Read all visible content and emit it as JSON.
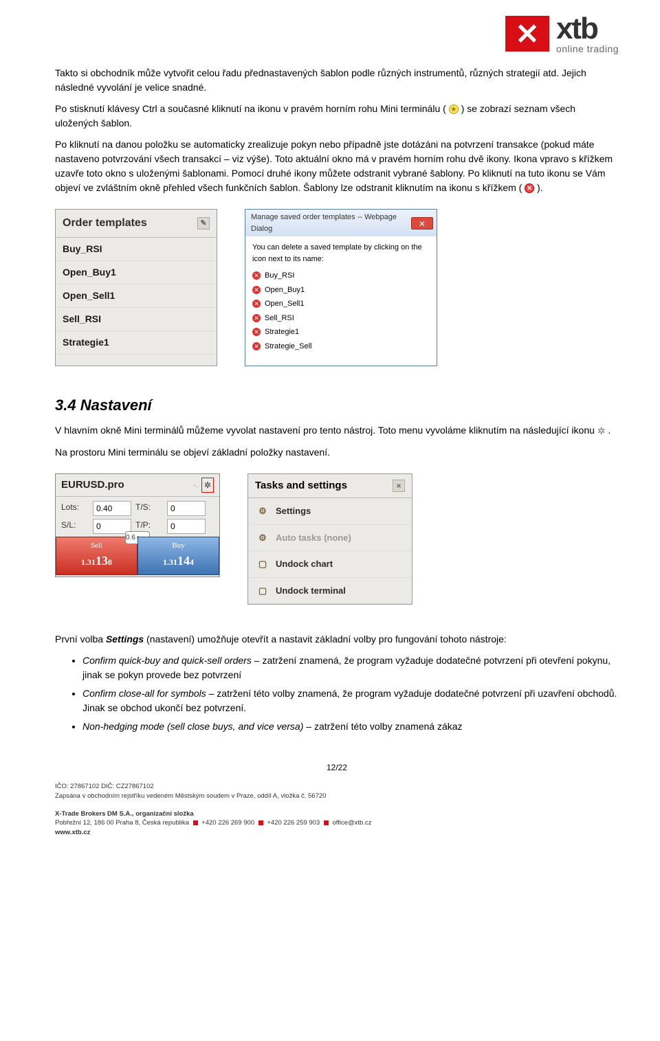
{
  "logo": {
    "brand": "xtb",
    "sub": "online trading"
  },
  "p1": "Takto si obchodník může vytvořit celou řadu přednastavených šablon podle různých instrumentů, různých strategií atd. Jejich následné vyvolání je velice snadné.",
  "p2a": "Po stisknutí klávesy Ctrl a současné kliknutí na ikonu v pravém horním rohu Mini terminálu (",
  "p2b": ") se zobrazí seznam všech uložených šablon.",
  "p3a": "Po kliknutí na danou položku se automaticky zrealizuje pokyn nebo případně jste dotázáni na potvrzení transakce (pokud máte nastaveno potvrzování všech transakcí – viz výše). Toto aktuální okno má v pravém horním rohu dvě ikony. Ikona vpravo s křížkem uzavře toto okno s uloženými šablonami. Pomocí druhé ikony můžete odstranit vybrané šablony. Po kliknutí na tuto ikonu se Vám objeví ve zvláštním okně přehled všech funkčních šablon. Šablony lze odstranit kliknutím na ikonu s křížkem (",
  "p3b": ").",
  "templates_panel": {
    "title": "Order templates",
    "items": [
      "Buy_RSI",
      "Open_Buy1",
      "Open_Sell1",
      "Sell_RSI",
      "Strategie1"
    ]
  },
  "dialog": {
    "title": "Manage saved order templates -- Webpage Dialog",
    "hint": "You can delete a saved template by clicking on the icon next to its name:",
    "items": [
      "Buy_RSI",
      "Open_Buy1",
      "Open_Sell1",
      "Sell_RSI",
      "Strategie1",
      "Strategie_Sell"
    ]
  },
  "sec34": "3.4 Nastavení",
  "p4a": "V hlavním okně Mini terminálů můžeme vyvolat nastavení pro tento nástroj. Toto menu vyvoláme kliknutím na následující ikonu ",
  "p4b": ".",
  "p5": "Na prostoru Mini terminálu se objeví základní položky nastavení.",
  "mini": {
    "symbol": "EURUSD.pro",
    "spark": "-.",
    "lots_lbl": "Lots:",
    "lots": "0.40",
    "ts_lbl": "T/S:",
    "ts": "0",
    "sl_lbl": "S/L:",
    "sl": "0",
    "tp_lbl": "T/P:",
    "tp": "0",
    "sell_lbl": "Sell",
    "buy_lbl": "Buy",
    "spread": "0.6",
    "sell_price_pre": "1.31",
    "sell_price_big": "13",
    "sell_price_suf": "8",
    "buy_price_pre": "1.31",
    "buy_price_big": "14",
    "buy_price_suf": "4"
  },
  "tasks": {
    "title": "Tasks and settings",
    "items": [
      {
        "label": "Settings",
        "dim": false
      },
      {
        "label": "Auto tasks (none)",
        "dim": true
      },
      {
        "label": "Undock chart",
        "dim": false
      },
      {
        "label": "Undock terminal",
        "dim": false
      }
    ]
  },
  "p6a": "První volba ",
  "p6b": "Settings",
  "p6c": " (nastavení) umožňuje otevřít a nastavit základní volby pro fungování tohoto nástroje:",
  "bullets": [
    {
      "em": "Confirm quick-buy and quick-sell orders",
      "rest": " – zatržení znamená, že program vyžaduje dodatečné potvrzení při otevření pokynu, jinak se pokyn provede bez potvrzení"
    },
    {
      "em": "Confirm close-all for symbols",
      "rest": " – zatržení této volby znamená, že program vyžaduje dodatečné potvrzení při uzavření obchodů. Jinak se obchod ukončí bez potvrzení."
    },
    {
      "em": "Non-hedging mode (sell close buys, and vice  versa)",
      "rest": " – zatržení této volby znamená zákaz"
    }
  ],
  "pageno": "12/22",
  "footer": {
    "l1": "IČO: 27867102 DIČ: CZ27867102",
    "l2": "Zapsána v obchodním rejstříku vedeném Městským soudem v Praze, oddíl A, vložka č. 56720",
    "l3": "X-Trade Brokers DM S.A., organizační složka",
    "l4a": "Pobřežní 12, 186 00 Praha 8, Česká republika",
    "l4b": "+420 226 269 900",
    "l4c": "+420 226 259 903",
    "l4d": "office@xtb.cz",
    "l5": "www.xtb.cz"
  }
}
